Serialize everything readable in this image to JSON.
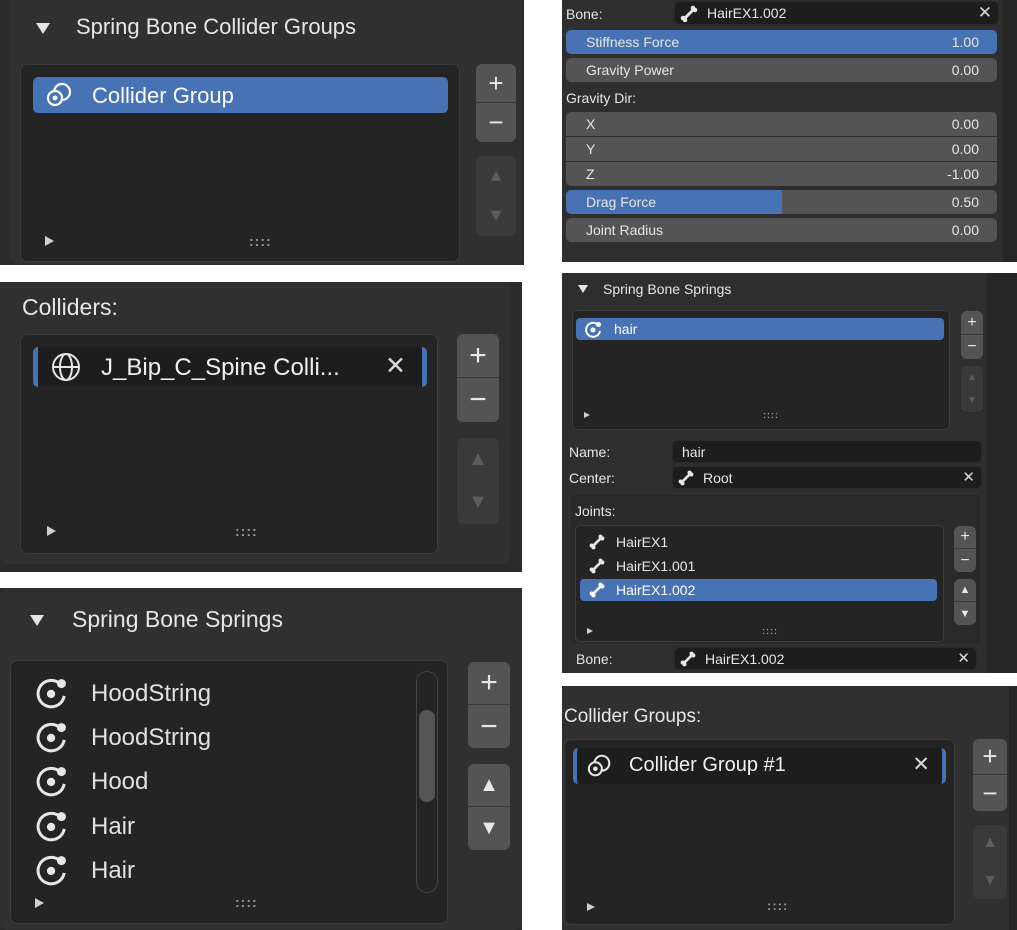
{
  "panel_a": {
    "header": "Spring Bone Collider Groups",
    "items": [
      "Collider Group"
    ],
    "add": "+",
    "remove": "−",
    "move_up": "▲",
    "move_down": "▼",
    "grip": "::::"
  },
  "panel_b": {
    "bone_label": "Bone:",
    "bone_value": "HairEX1.002",
    "stiffness_label": "Stiffness Force",
    "stiffness_value": "1.00",
    "gravity_power_label": "Gravity Power",
    "gravity_power_value": "0.00",
    "gravity_dir_label": "Gravity Dir:",
    "x_label": "X",
    "x_value": "0.00",
    "y_label": "Y",
    "y_value": "0.00",
    "z_label": "Z",
    "z_value": "-1.00",
    "drag_label": "Drag Force",
    "drag_value": "0.50",
    "drag_fraction": 0.5,
    "joint_radius_label": "Joint Radius",
    "joint_radius_value": "0.00"
  },
  "panel_c": {
    "label": "Colliders:",
    "items": [
      "J_Bip_C_Spine Colli..."
    ],
    "add": "+",
    "remove": "−",
    "move_up": "▲",
    "move_down": "▼",
    "grip": "::::"
  },
  "panel_d": {
    "header": "Spring Bone Springs",
    "springs": [
      "hair"
    ],
    "name_label": "Name:",
    "name_value": "hair",
    "center_label": "Center:",
    "center_value": "Root",
    "joints_label": "Joints:",
    "joints": [
      "HairEX1",
      "HairEX1.001",
      "HairEX1.002"
    ],
    "bone_label": "Bone:",
    "bone_value": "HairEX1.002",
    "add": "+",
    "remove": "−",
    "move_up": "▲",
    "move_down": "▼",
    "grip": "::::"
  },
  "panel_e": {
    "header": "Spring Bone Springs",
    "items": [
      "HoodString",
      "HoodString",
      "Hood",
      "Hair",
      "Hair"
    ],
    "add": "+",
    "remove": "−",
    "move_up": "▲",
    "move_down": "▼",
    "grip": "::::"
  },
  "panel_f": {
    "label": "Collider Groups:",
    "items": [
      "Collider Group #1"
    ],
    "add": "+",
    "remove": "−",
    "move_up": "▲",
    "move_down": "▼",
    "grip": "::::"
  },
  "colors": {
    "accent": "#4772b3",
    "panel": "#303030",
    "list": "#242424",
    "button": "#545454"
  }
}
